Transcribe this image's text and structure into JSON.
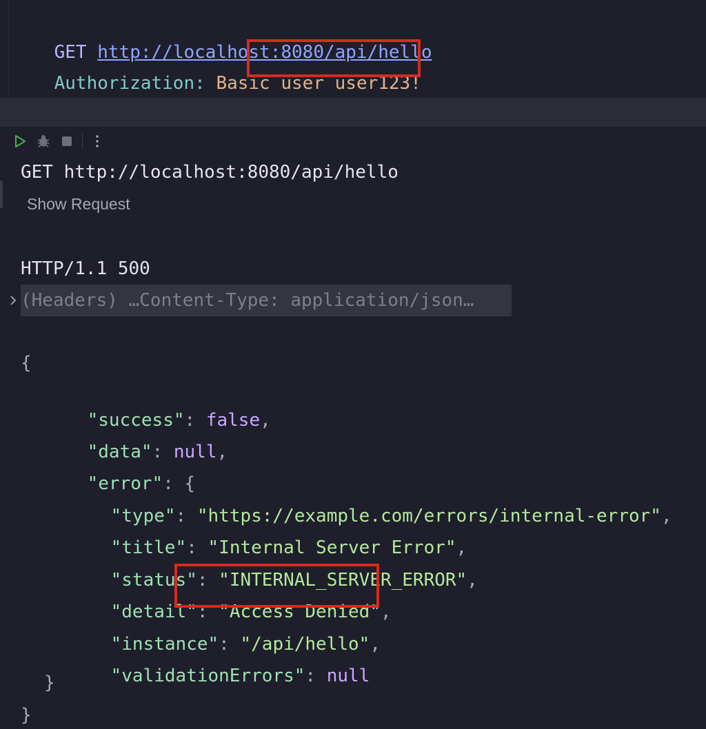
{
  "request": {
    "method": "GET",
    "url": "http://localhost:8080/api/hello",
    "header_name": "Authorization:",
    "header_scheme": "Basic",
    "header_credentials": "user user123!"
  },
  "response": {
    "request_line": "GET http://localhost:8080/api/hello",
    "show_request_label": "Show Request",
    "status_line": "HTTP/1.1 500",
    "headers_summary": "(Headers) …Content-Type: application/json…",
    "body": {
      "open_brace": "{",
      "close_brace": "}",
      "success_key": "\"success\"",
      "success_val": "false",
      "data_key": "\"data\"",
      "data_val": "null",
      "error_key": "\"error\"",
      "error_open": "{",
      "error_close": "}",
      "type_key": "\"type\"",
      "type_val": "\"https://example.com/errors/internal-error\"",
      "title_key": "\"title\"",
      "title_val": "\"Internal Server Error\"",
      "status_key": "\"status\"",
      "status_val": "\"INTERNAL_SERVER_ERROR\"",
      "detail_key": "\"detail\"",
      "detail_val": "\"Access Denied\"",
      "instance_key": "\"instance\"",
      "instance_val": "\"/api/hello\"",
      "validation_key": "\"validationErrors\"",
      "validation_val": "null"
    }
  },
  "toolbar": {
    "icons": [
      "run-icon",
      "debug-icon",
      "stop-icon",
      "more-options-icon"
    ]
  },
  "colors": {
    "highlight": "#d62b1e",
    "background": "#1e1f2b"
  }
}
